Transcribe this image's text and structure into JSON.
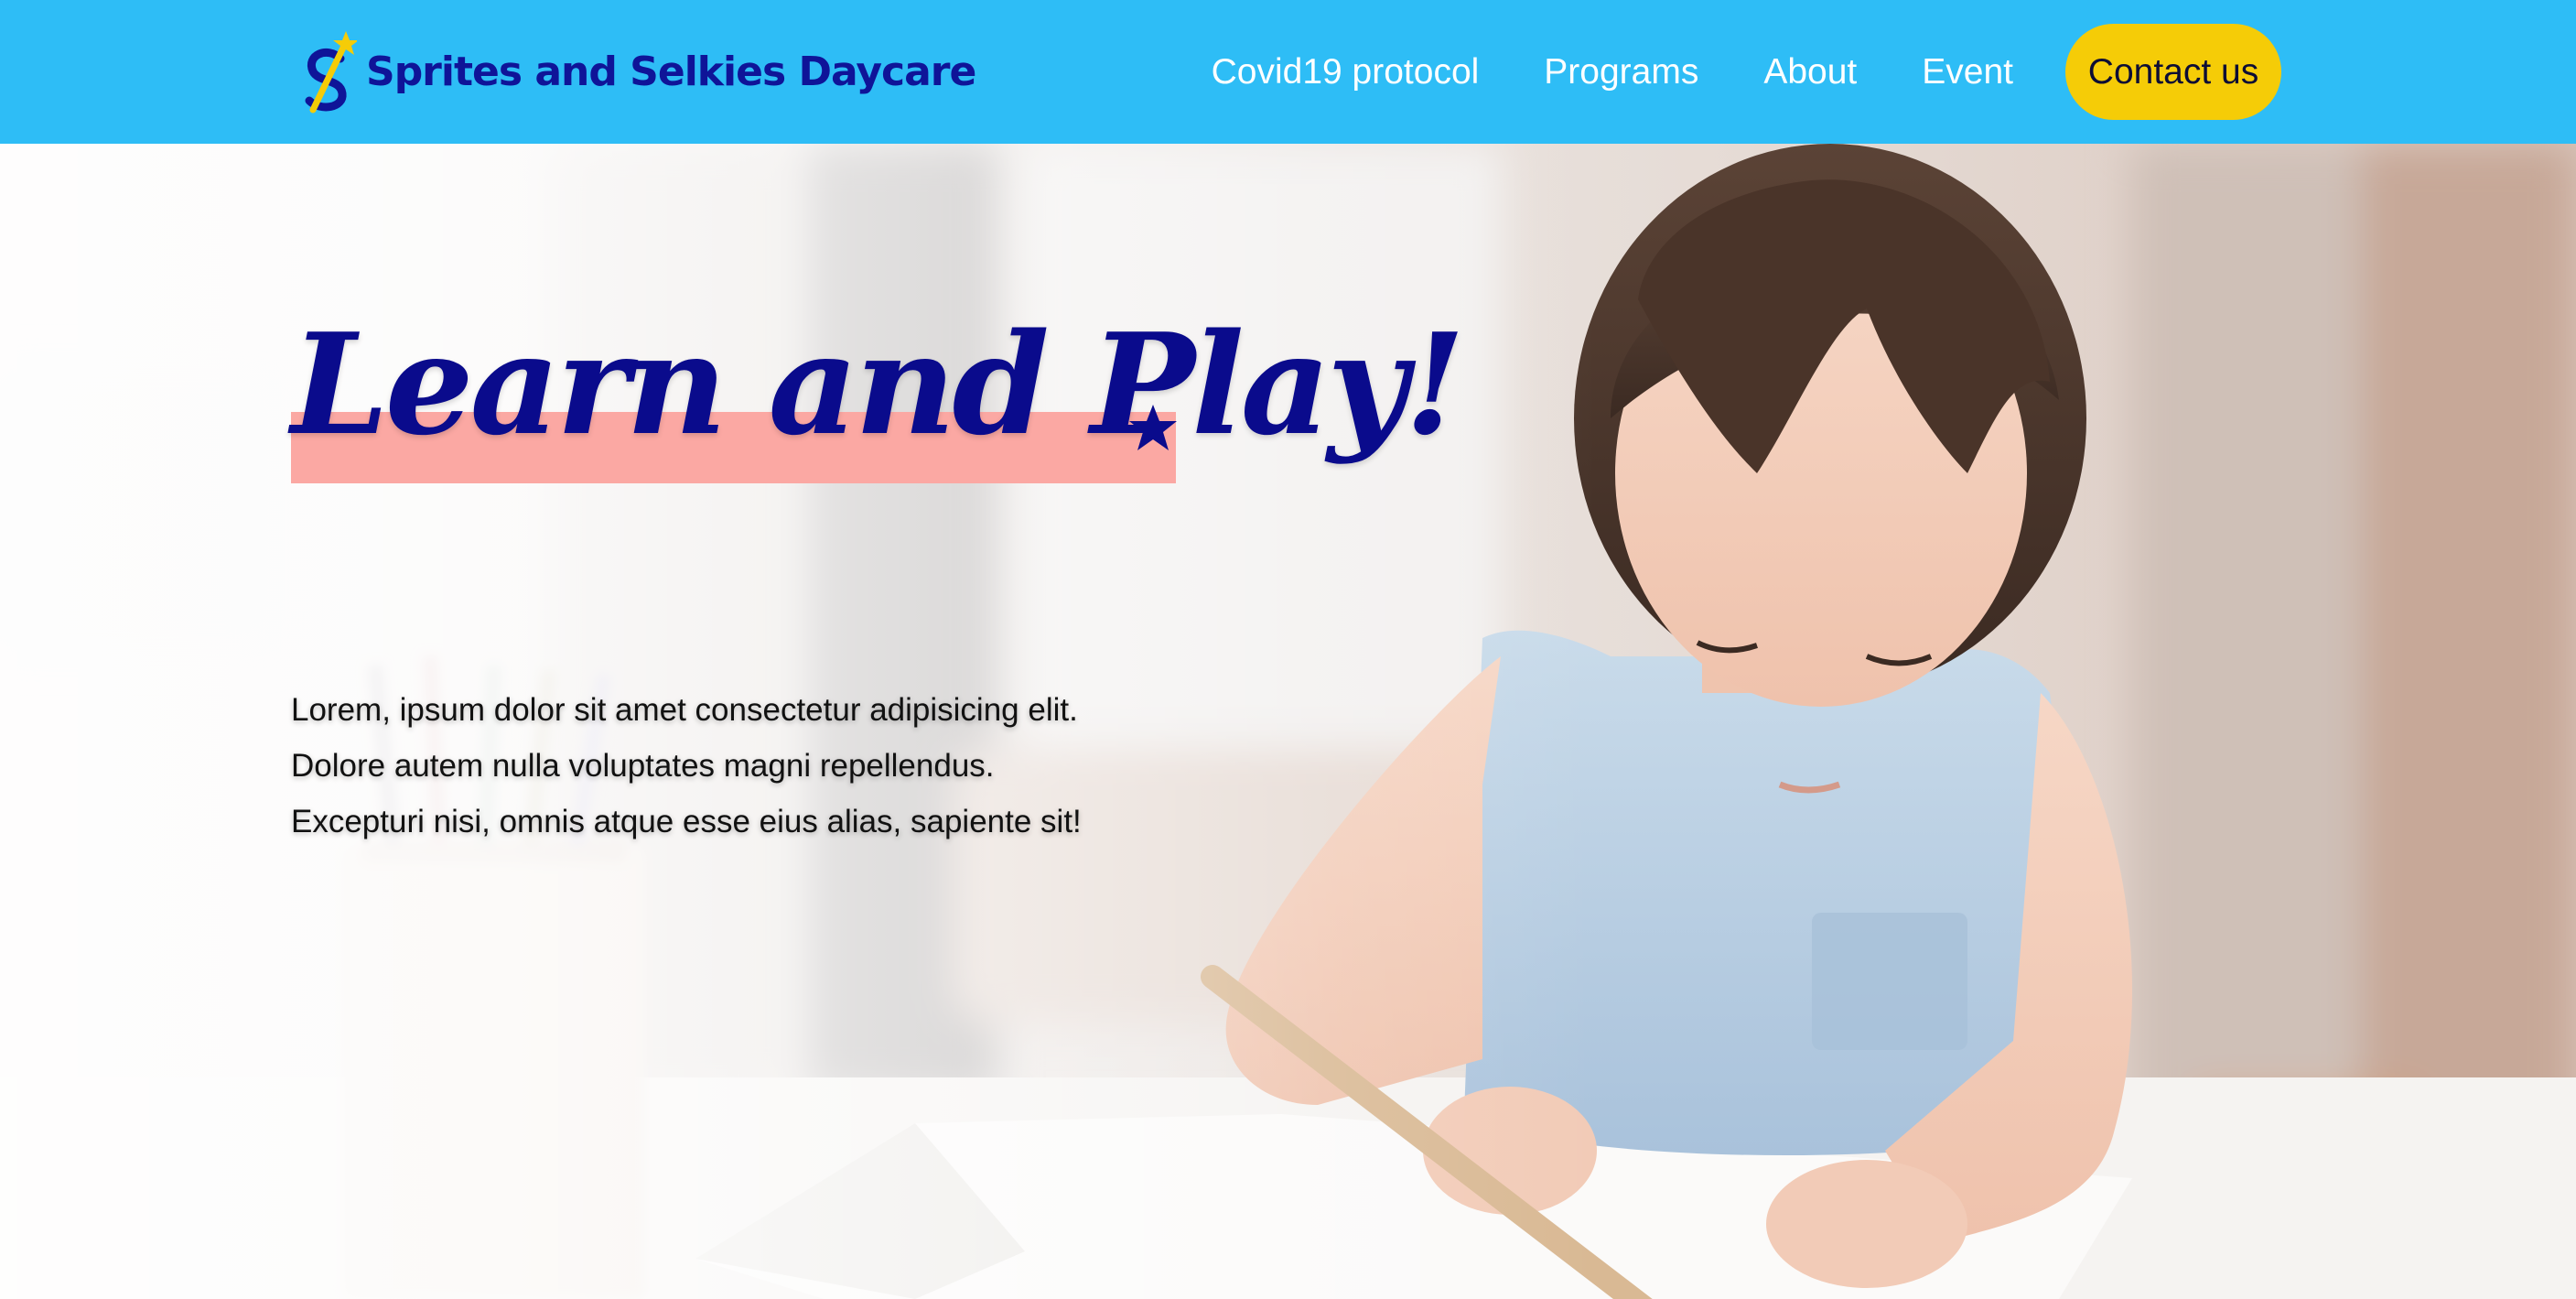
{
  "header": {
    "brand_name": "Sprites and Selkies Daycare",
    "logo_icon": "wand-s-logo-icon",
    "nav_items": [
      "Covid19 protocol",
      "Programs",
      "About",
      "Event"
    ],
    "contact_label": "Contact us"
  },
  "hero": {
    "headline": "Learn and Play",
    "headline_punctuation": "!",
    "paragraph_lines": [
      "Lorem, ipsum dolor sit amet consectetur adipisicing elit.",
      "Dolore autem nulla voluptates magni repellendus.",
      "Excepturi nisi, omnis atque esse eius alias, sapiente sit!"
    ],
    "background_image": "child-drawing-with-pencil-photo"
  },
  "colors": {
    "nav_bg": "#2ebdf6",
    "brand_text": "#0f1498",
    "contact_btn": "#f5cc07",
    "headline": "#0a0b8c",
    "headline_highlight": "#fba8a3"
  }
}
